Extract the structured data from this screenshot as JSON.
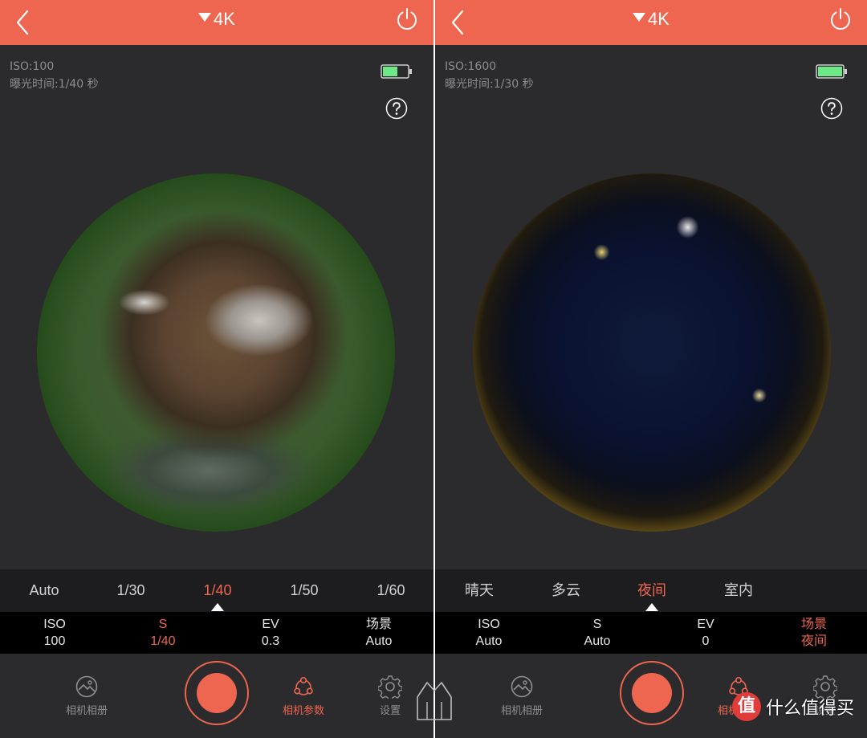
{
  "colors": {
    "accent": "#ee6650",
    "background": "#2b2b2d",
    "battery": "#6ee886"
  },
  "left": {
    "resolution": "4K",
    "iso_text": "ISO:100",
    "exposure_text": "曝光时间:1/40 秒",
    "battery_level": 0.6,
    "shutter_options": [
      "Auto",
      "1/30",
      "1/40",
      "1/50",
      "1/60"
    ],
    "selected_option_index": 2,
    "params": [
      {
        "label": "ISO",
        "value": "100"
      },
      {
        "label": "S",
        "value": "1/40"
      },
      {
        "label": "EV",
        "value": "0.3"
      },
      {
        "label": "场景",
        "value": "Auto"
      }
    ],
    "active_param_index": 1,
    "nav": {
      "album": "相机相册",
      "params": "相机参数",
      "settings": "设置"
    }
  },
  "right": {
    "resolution": "4K",
    "iso_text": "ISO:1600",
    "exposure_text": "曝光时间:1/30 秒",
    "battery_level": 1.0,
    "scene_options": [
      "晴天",
      "多云",
      "夜间",
      "室内"
    ],
    "selected_option_index": 2,
    "params": [
      {
        "label": "ISO",
        "value": "Auto"
      },
      {
        "label": "S",
        "value": "Auto"
      },
      {
        "label": "EV",
        "value": "0"
      },
      {
        "label": "场景",
        "value": "夜间"
      }
    ],
    "active_param_index": 3,
    "nav": {
      "album": "相机相册",
      "params": "相机参数",
      "settings": "设置"
    }
  },
  "watermark": {
    "badge": "值",
    "text": "什么值得买"
  },
  "icons": [
    "back-icon",
    "dropdown-triangle-icon",
    "power-icon",
    "battery-icon",
    "help-icon",
    "album-icon",
    "params-icon",
    "gear-icon",
    "home-icon"
  ]
}
